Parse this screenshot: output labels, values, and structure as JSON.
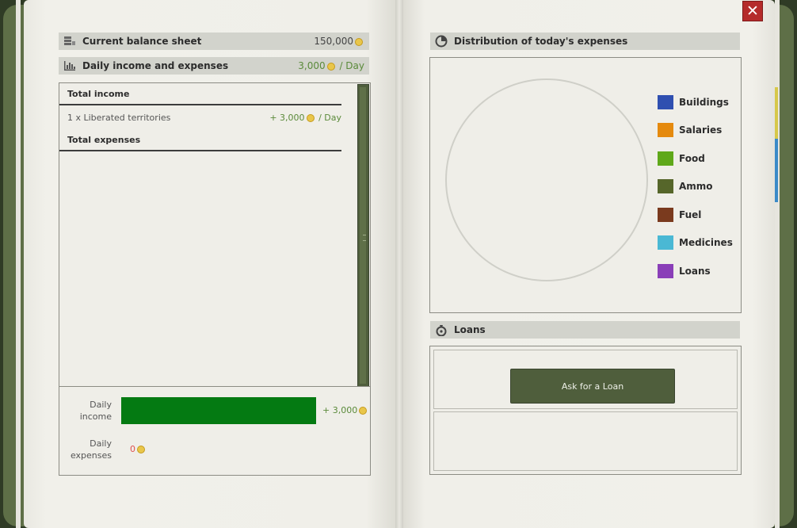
{
  "left": {
    "balance": {
      "label": "Current balance sheet",
      "value": "150,000",
      "icon": "coins-stack-icon"
    },
    "daily": {
      "label": "Daily income and expenses",
      "value": "3,000",
      "unit": "/ Day",
      "icon": "bar-chart-icon"
    },
    "table": {
      "income_header": "Total income",
      "income_rows": [
        {
          "label": "1 x Liberated territories",
          "value": "+ 3,000",
          "unit": "/ Day"
        }
      ],
      "expenses_header": "Total expenses"
    },
    "summary": {
      "income_label_1": "Daily",
      "income_label_2": "income",
      "income_value": "+ 3,000",
      "expenses_label_1": "Daily",
      "expenses_label_2": "expenses",
      "expenses_value": "0"
    }
  },
  "right": {
    "distribution": {
      "title": "Distribution of today's expenses",
      "icon": "pie-chart-icon"
    },
    "legend": [
      {
        "label": "Buildings",
        "color": "#2f4fb0"
      },
      {
        "label": "Salaries",
        "color": "#e58a0e"
      },
      {
        "label": "Food",
        "color": "#5fa81a"
      },
      {
        "label": "Ammo",
        "color": "#56662a"
      },
      {
        "label": "Fuel",
        "color": "#7a3a1e"
      },
      {
        "label": "Medicines",
        "color": "#4ab8d4"
      },
      {
        "label": "Loans",
        "color": "#8a3fb8"
      }
    ],
    "loans": {
      "title": "Loans",
      "icon": "money-bag-icon",
      "button": "Ask for a Loan"
    }
  },
  "colors": {
    "income_bar": "#047a12",
    "positive": "#5a8a3a",
    "negative": "#e05050",
    "close": "#b52b2b"
  }
}
